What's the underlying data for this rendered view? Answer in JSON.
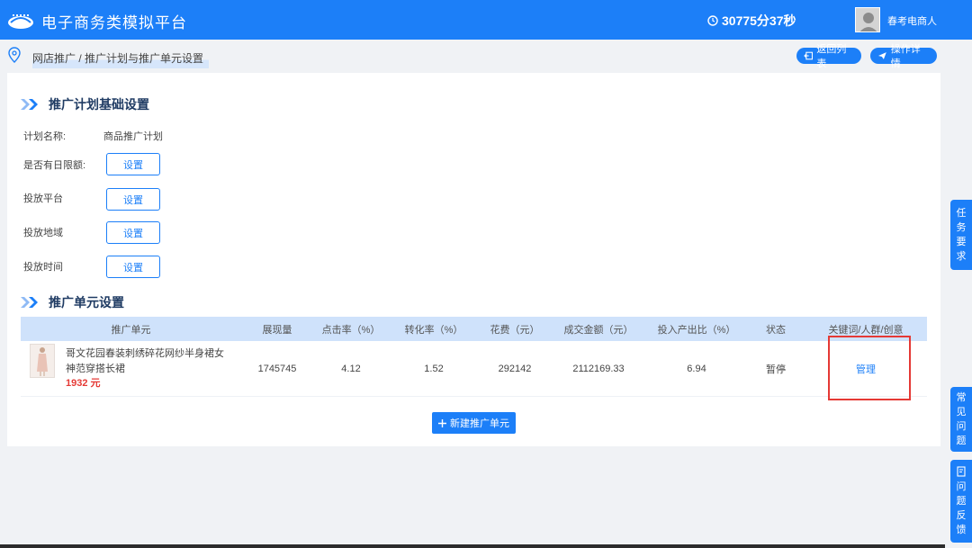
{
  "app": {
    "title": "电子商务类模拟平台"
  },
  "header": {
    "timer": "30775分37秒",
    "user_name": "春考电商人"
  },
  "breadcrumb": "网店推广 / 推广计划与推广单元设置",
  "actions": {
    "back_label": "返回列表",
    "detail_label": "操作详情"
  },
  "basic_section": {
    "title": "推广计划基础设置",
    "plan_name_label": "计划名称:",
    "plan_name_value": "商品推广计划",
    "daily_limit_label": "是否有日限额:",
    "platform_label": "投放平台",
    "region_label": "投放地域",
    "time_label": "投放时间",
    "set_button_label": "设置"
  },
  "unit_section": {
    "title": "推广单元设置",
    "columns": [
      "推广单元",
      "展现量",
      "点击率（%）",
      "转化率（%）",
      "花费（元）",
      "成交金额（元）",
      "投入产出比（%）",
      "状态",
      "关键词/人群/创意"
    ],
    "rows": [
      {
        "name": "哥文花园春装刺绣碎花网纱半身裙女神范穿搭长裙",
        "price": "1932 元",
        "impressions": "1745745",
        "ctr": "4.12",
        "cvr": "1.52",
        "cost": "292142",
        "gmv": "2112169.33",
        "roi": "6.94",
        "status": "暂停",
        "action": "管理"
      }
    ],
    "new_unit_label": "新建推广单元"
  },
  "side_tabs": {
    "task": [
      "任",
      "务",
      "要",
      "求"
    ],
    "faq": [
      "常",
      "见",
      "问",
      "题"
    ],
    "feedback": [
      "问",
      "题",
      "反",
      "馈"
    ]
  },
  "colors": {
    "primary": "#1c7ff8",
    "price_red": "#e53935",
    "header_bg": "#cfe2fb"
  },
  "icons": [
    "logo-icon",
    "clock-icon",
    "location-pin-icon",
    "back-icon",
    "send-icon",
    "chevron-double-icon",
    "plus-icon",
    "edit-icon"
  ]
}
